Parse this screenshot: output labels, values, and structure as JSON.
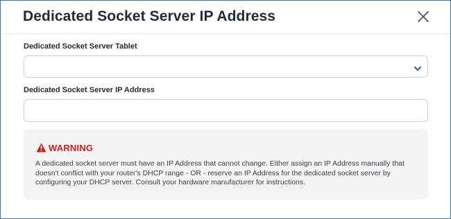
{
  "dialog": {
    "title": "Dedicated Socket Server IP Address",
    "close_icon": "close-x-icon"
  },
  "form": {
    "tablet_label": "Dedicated Socket Server Tablet",
    "tablet_selected_value": "",
    "tablet_chevron_icon": "chevron-down-icon",
    "ip_label": "Dedicated Socket Server IP Address",
    "ip_value": "",
    "ip_placeholder": ""
  },
  "warning": {
    "icon": "warning-triangle-icon",
    "title": "WARNING",
    "body": "A dedicated socket server must have an IP Address that cannot change. Either assign an IP Address manually that doesn't conflict with your router's DHCP range - OR - reserve an IP Address for the dedicated socket server by configuring your DHCP server. Consult your hardware manufacturer for instructions."
  },
  "colors": {
    "border_accent": "#3d6fb0",
    "warning_red": "#d11a1a",
    "chevron_blue": "#1f5fa8",
    "warning_bg": "#f4f4f5"
  }
}
